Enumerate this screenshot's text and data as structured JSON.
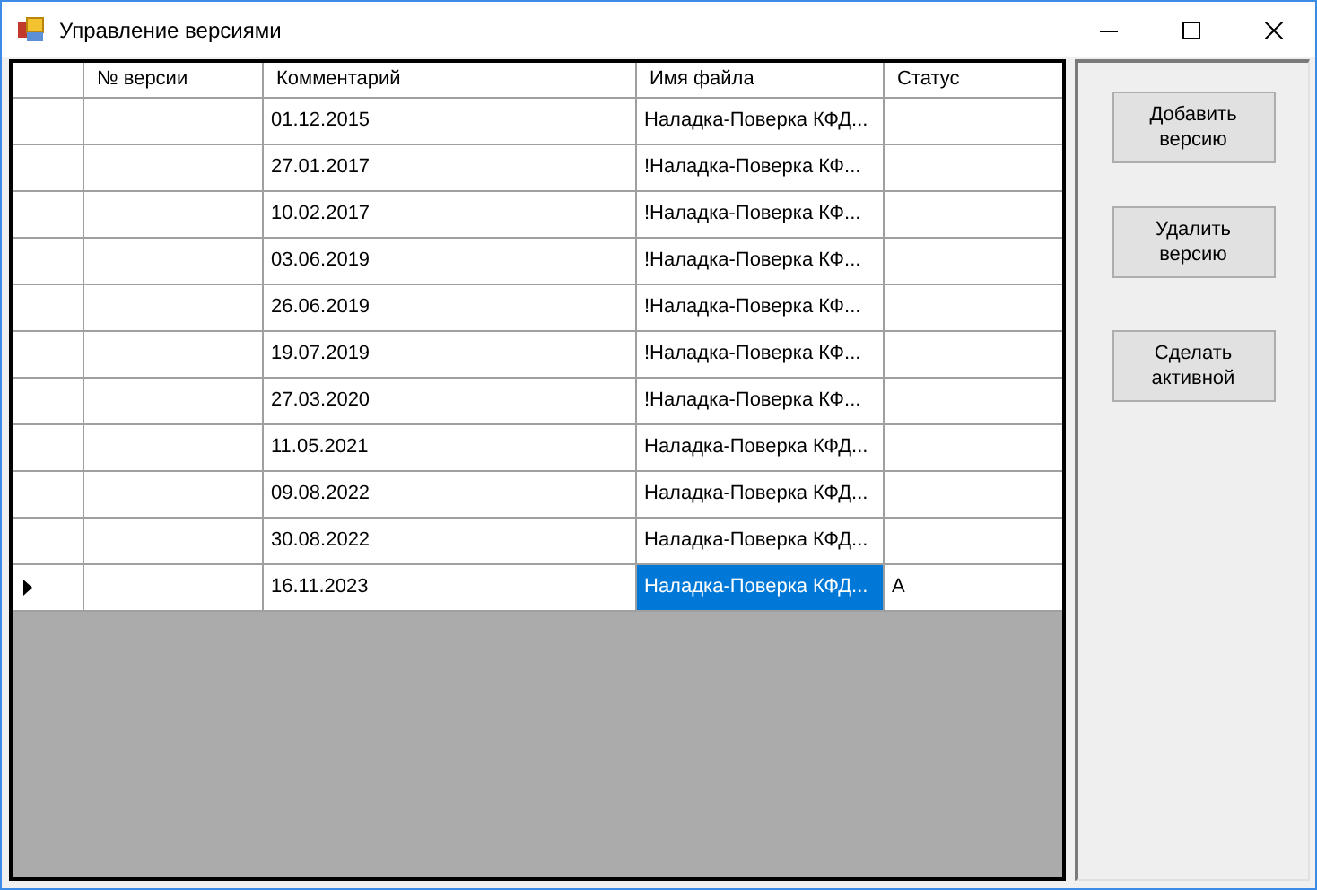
{
  "window": {
    "title": "Управление версиями"
  },
  "table": {
    "columns": [
      "№ версии",
      "Комментарий",
      "Имя файла",
      "Статус"
    ],
    "rows": [
      {
        "comment": "01.12.2015",
        "file": "Наладка-Поверка КФД...",
        "current": false,
        "selected": false
      },
      {
        "comment": "27.01.2017",
        "file": "!Наладка-Поверка КФ...",
        "current": false,
        "selected": false
      },
      {
        "comment": "10.02.2017",
        "file": "!Наладка-Поверка КФ...",
        "current": false,
        "selected": false
      },
      {
        "comment": "03.06.2019",
        "file": "!Наладка-Поверка КФ...",
        "current": false,
        "selected": false
      },
      {
        "comment": "26.06.2019",
        "file": "!Наладка-Поверка КФ...",
        "current": false,
        "selected": false
      },
      {
        "comment": "19.07.2019",
        "file": "!Наладка-Поверка КФ...",
        "current": false,
        "selected": false
      },
      {
        "comment": "27.03.2020",
        "file": "!Наладка-Поверка КФ...",
        "current": false,
        "selected": false
      },
      {
        "comment": "11.05.2021",
        "file": "Наладка-Поверка КФД...",
        "current": false,
        "selected": false
      },
      {
        "comment": "09.08.2022",
        "file": "Наладка-Поверка КФД...",
        "current": false,
        "selected": false
      },
      {
        "comment": "30.08.2022",
        "file": "Наладка-Поверка КФД...",
        "current": false,
        "selected": false
      },
      {
        "comment": "16.11.2023",
        "file": "Наладка-Поверка КФД...",
        "status": "A",
        "current": true,
        "selected": true
      }
    ]
  },
  "buttons": [
    "Добавить версию",
    "Удалить версию",
    "Сделать активной"
  ]
}
